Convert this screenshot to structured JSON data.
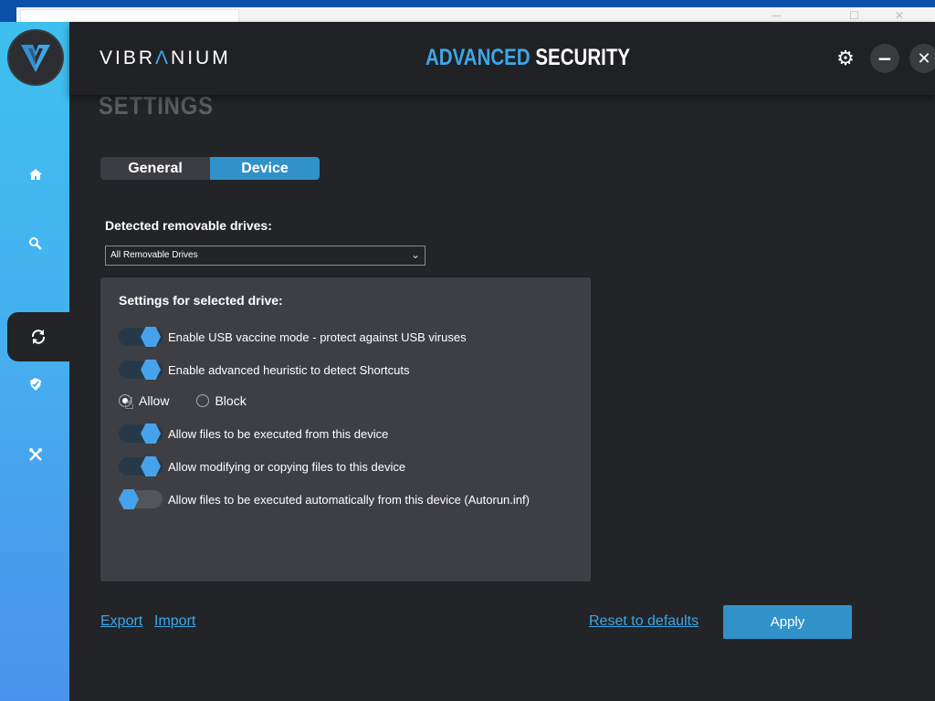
{
  "brand": {
    "prefix": "VIBR",
    "accent": "Λ",
    "suffix": "NIUM"
  },
  "product": {
    "part1": "ADVANCED",
    "part2": "SECURITY"
  },
  "page_title": "SETTINGS",
  "tabs": [
    {
      "label": "General",
      "active": false
    },
    {
      "label": "Device",
      "active": true
    }
  ],
  "drives": {
    "label": "Detected removable drives:",
    "selected": "All Removable Drives"
  },
  "panel": {
    "title": "Settings for selected drive:",
    "toggles": [
      {
        "label": "Enable USB vaccine mode - protect against USB viruses",
        "on": true
      },
      {
        "label": "Enable advanced heuristic to detect Shortcuts",
        "on": true
      },
      {
        "label": "Allow files to be executed from this device",
        "on": true
      },
      {
        "label": "Allow modifying or copying files to this device",
        "on": true
      },
      {
        "label": "Allow files to be executed automatically from this device (Autorun.inf)",
        "on": false
      }
    ],
    "radio": {
      "allow": "Allow",
      "block": "Block",
      "selected": "Allow"
    }
  },
  "footer": {
    "export": "Export",
    "import": "Import",
    "reset": "Reset to defaults",
    "apply": "Apply"
  },
  "icons": {
    "home": "home-icon",
    "search": "search-icon",
    "update": "refresh-icon",
    "tools": "tools-icon",
    "shield": "shield-icon",
    "gear": "gear-icon"
  },
  "colors": {
    "accent": "#3ea7e6",
    "button": "#3192c9",
    "sidebar_top": "#3ec0ef",
    "sidebar_bottom": "#4a93ec"
  }
}
